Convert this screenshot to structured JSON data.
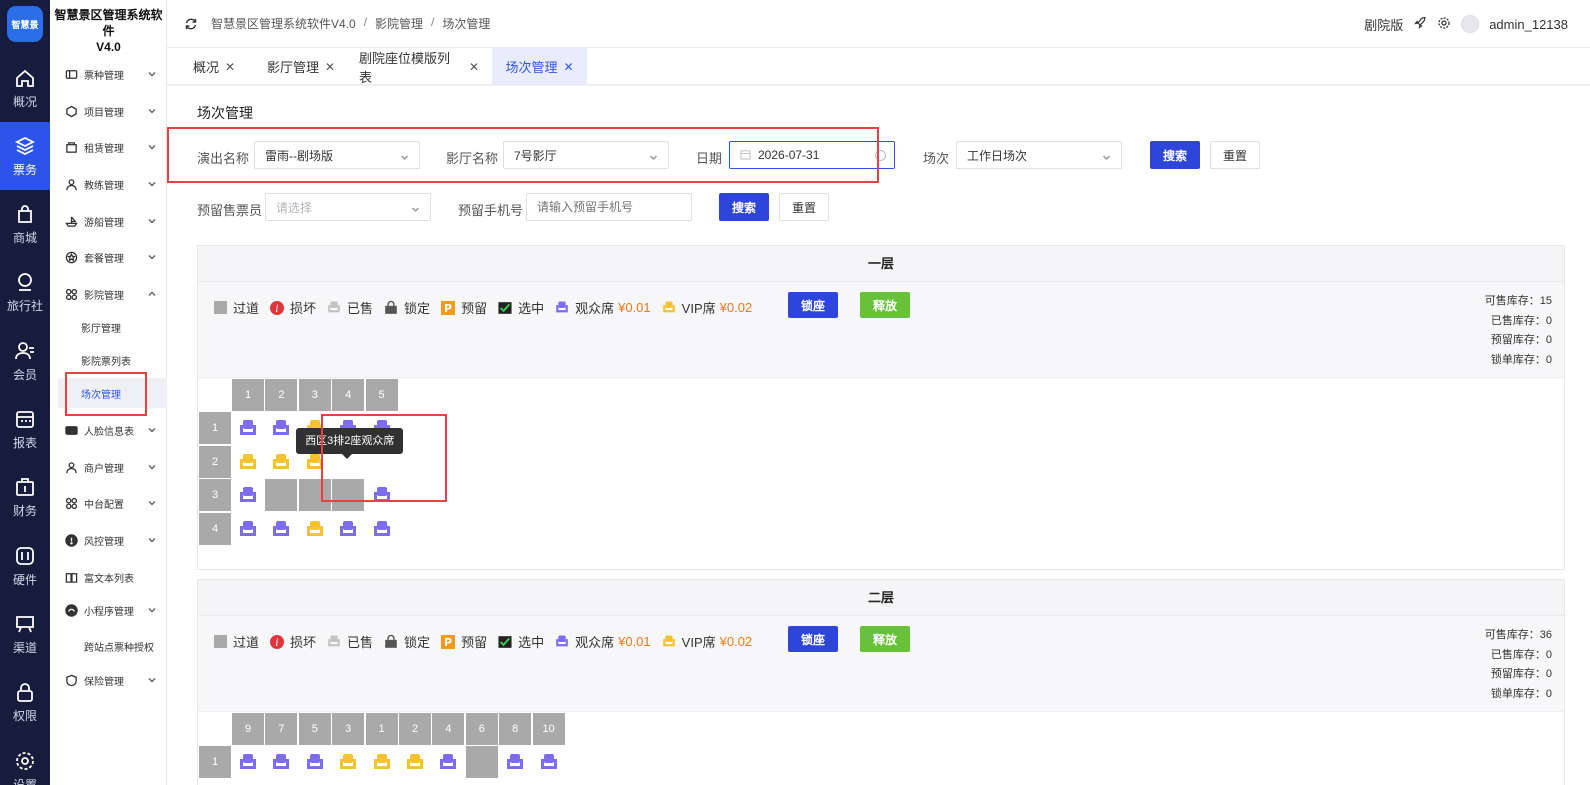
{
  "app": {
    "title_line1": "智慧景区管理系统软件",
    "title_line2": "V4.0",
    "logo_text": "智慧景"
  },
  "rail": [
    {
      "label": "概况",
      "icon": "home-icon"
    },
    {
      "label": "票务",
      "icon": "layers-icon",
      "active": true
    },
    {
      "label": "商城",
      "icon": "shop-bag-icon"
    },
    {
      "label": "旅行社",
      "icon": "travel-agency-icon"
    },
    {
      "label": "会员",
      "icon": "member-icon"
    },
    {
      "label": "报表",
      "icon": "report-icon"
    },
    {
      "label": "财务",
      "icon": "finance-icon"
    },
    {
      "label": "硬件",
      "icon": "hardware-icon"
    },
    {
      "label": "渠道",
      "icon": "channel-icon"
    },
    {
      "label": "权限",
      "icon": "lock-icon"
    },
    {
      "label": "设置",
      "icon": "gear-icon"
    }
  ],
  "menu": {
    "ticket_type": "票种管理",
    "project": "项目管理",
    "rental": "租赁管理",
    "coach": "教练管理",
    "boat": "游船管理",
    "package": "套餐管理",
    "cinema": "影院管理",
    "cinema_sub": [
      "影厅管理",
      "影院票列表",
      "场次管理"
    ],
    "face": "人脸信息表",
    "merchant": "商户管理",
    "platform": "中台配置",
    "risk": "风控管理",
    "richtext": "富文本列表",
    "miniapp": "小程序管理",
    "cross_site": "跨站点票种授权",
    "insurance": "保险管理"
  },
  "header": {
    "breadcrumbs": [
      "智慧景区管理系统软件V4.0",
      "影院管理",
      "场次管理"
    ],
    "version_label": "剧院版",
    "username": "admin_12138"
  },
  "tabs": [
    {
      "label": "概况"
    },
    {
      "label": "影厅管理"
    },
    {
      "label": "剧院座位模版列表"
    },
    {
      "label": "场次管理",
      "active": true
    }
  ],
  "page": {
    "title": "场次管理"
  },
  "filters": {
    "show_name_label": "演出名称",
    "show_name_value": "雷雨--剧场版",
    "hall_label": "影厅名称",
    "hall_value": "7号影厅",
    "date_label": "日期",
    "date_value": "2026-07-31",
    "session_label": "场次",
    "session_value": "工作日场次",
    "search": "搜索",
    "reset": "重置",
    "presale_label": "预留售票员",
    "presale_placeholder": "请选择",
    "phone_label": "预留手机号",
    "phone_placeholder": "请输入预留手机号",
    "search2": "搜索",
    "reset2": "重置"
  },
  "legend": {
    "aisle": "过道",
    "damaged": "损坏",
    "sold": "已售",
    "locked": "锁定",
    "reserved": "预留",
    "selected": "选中",
    "audience": "观众席",
    "audience_price": "¥0.01",
    "vip": "VIP席",
    "vip_price": "¥0.02",
    "lock_btn": "锁座",
    "release_btn": "释放"
  },
  "colors": {
    "audience": "#7b6cf0",
    "vip": "#f5c230",
    "aisle": "#a9a9a9",
    "primary": "#2d45d8",
    "release": "#67c23a",
    "price": "#f07a17"
  },
  "floors": [
    {
      "title": "一层",
      "stock": {
        "available": "可售库存：15",
        "sold": "已售库存：0",
        "reserved": "预留库存：0",
        "locked": "锁单库存：0"
      },
      "columns": [
        "1",
        "2",
        "3",
        "4",
        "5"
      ],
      "rows": [
        {
          "label": "1",
          "seats": [
            "A",
            "A",
            "V",
            "A",
            "A"
          ]
        },
        {
          "label": "2",
          "seats": [
            "V",
            "V",
            "V",
            "-",
            "-"
          ]
        },
        {
          "label": "3",
          "seats": [
            "A",
            "X",
            "X",
            "X",
            "A"
          ]
        },
        {
          "label": "4",
          "seats": [
            "A",
            "A",
            "V",
            "A",
            "A"
          ]
        }
      ],
      "tooltip": "西区3排2座观众席"
    },
    {
      "title": "二层",
      "stock": {
        "available": "可售库存：36",
        "sold": "已售库存：0",
        "reserved": "预留库存：0",
        "locked": "锁单库存：0"
      },
      "columns": [
        "9",
        "7",
        "5",
        "3",
        "1",
        "2",
        "4",
        "6",
        "8",
        "10"
      ],
      "rows": [
        {
          "label": "1",
          "seats": [
            "A",
            "A",
            "A",
            "V",
            "V",
            "V",
            "A",
            "X",
            "A",
            "A"
          ]
        }
      ]
    }
  ]
}
